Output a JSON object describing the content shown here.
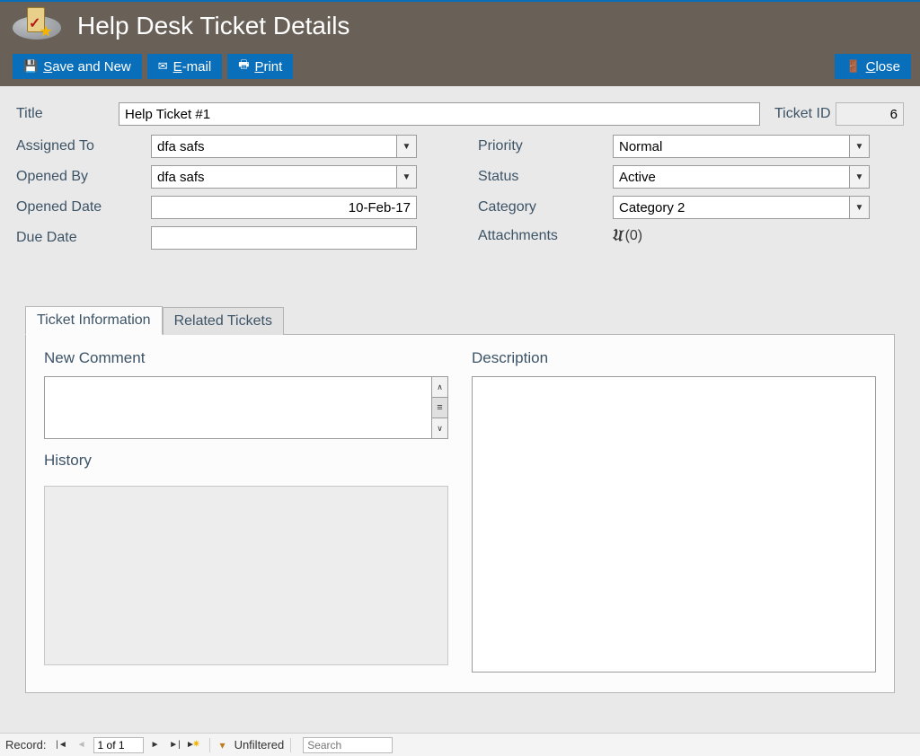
{
  "header": {
    "title": "Help Desk Ticket Details",
    "buttons": {
      "save_new_pre": "S",
      "save_new_post": "ave and New",
      "email_pre": "E",
      "email_post": "-mail",
      "print_pre": "P",
      "print_post": "rint",
      "close_pre": "C",
      "close_post": "lose"
    }
  },
  "form": {
    "title_label": "Title",
    "title_value": "Help Ticket #1",
    "ticket_id_label": "Ticket ID",
    "ticket_id_value": "6",
    "assigned_label": "Assigned To",
    "assigned_value": "dfa safs",
    "opened_by_label": "Opened By",
    "opened_by_value": "dfa safs",
    "opened_date_label": "Opened Date",
    "opened_date_value": "10-Feb-17",
    "due_date_label": "Due Date",
    "due_date_value": "",
    "priority_label": "Priority",
    "priority_value": "Normal",
    "status_label": "Status",
    "status_value": "Active",
    "category_label": "Category",
    "category_value": "Category 2",
    "attachments_label": "Attachments",
    "attachments_count": "(0)"
  },
  "tabs": {
    "info": "Ticket Information",
    "related": "Related Tickets",
    "new_comment": "New Comment",
    "history": "History",
    "description": "Description"
  },
  "nav": {
    "record_label": "Record:",
    "position": "1 of 1",
    "filter_text": "Unfiltered",
    "search_placeholder": "Search"
  }
}
